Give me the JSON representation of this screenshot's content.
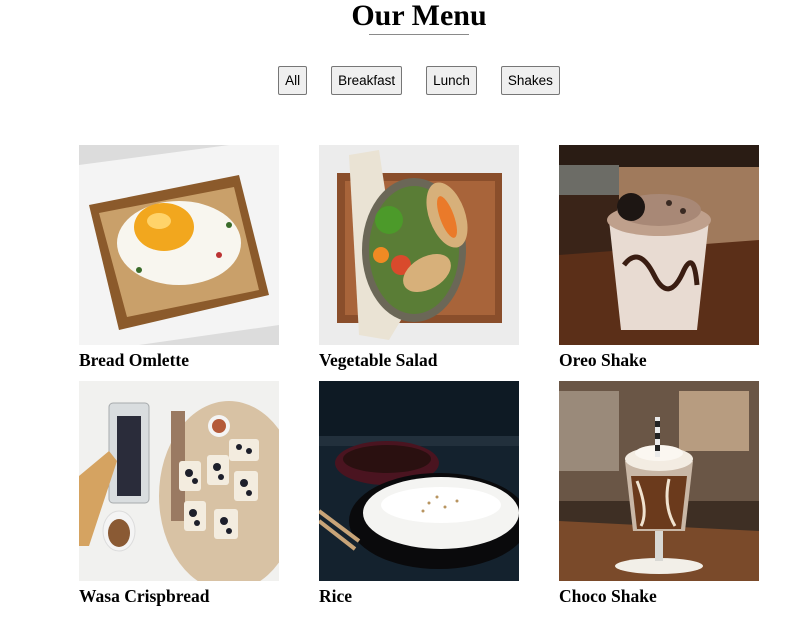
{
  "header": {
    "title": "Our Menu"
  },
  "filters": [
    {
      "label": "All"
    },
    {
      "label": "Breakfast"
    },
    {
      "label": "Lunch"
    },
    {
      "label": "Shakes"
    }
  ],
  "menu": {
    "items": [
      {
        "name": "Bread Omlette"
      },
      {
        "name": "Vegetable Salad"
      },
      {
        "name": "Oreo Shake"
      },
      {
        "name": "Wasa Crispbread"
      },
      {
        "name": "Rice"
      },
      {
        "name": "Choco Shake"
      }
    ]
  }
}
